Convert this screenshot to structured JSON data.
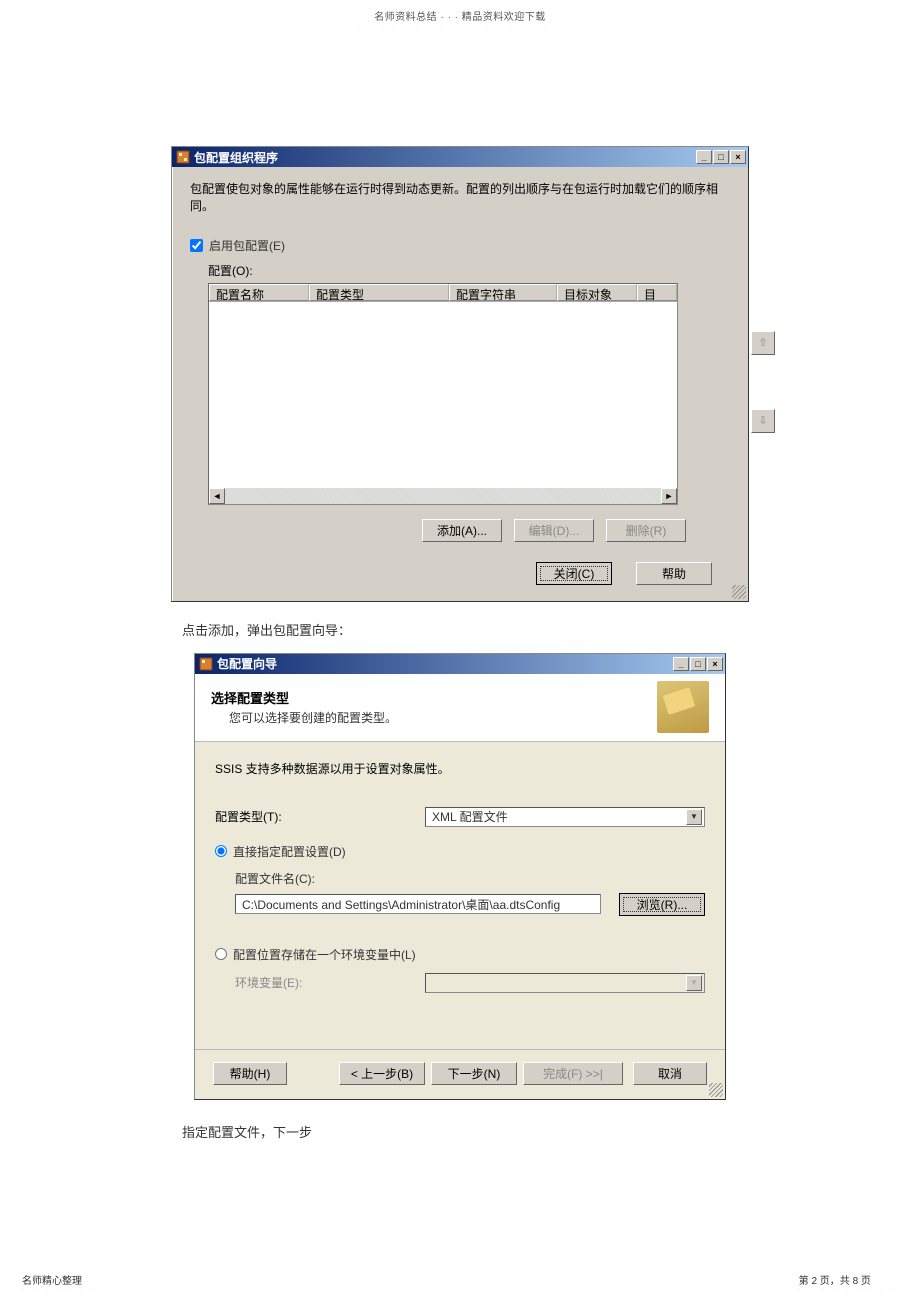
{
  "page_header": {
    "text": "名师资料总结 · · · 精品资料欢迎下载"
  },
  "dialog1": {
    "title": "包配置组织程序",
    "description": "包配置使包对象的属性能够在运行时得到动态更新。配置的列出顺序与在包运行时加载它们的顺序相同。",
    "enable_checkbox": "启用包配置(E)",
    "config_label": "配置(O):",
    "columns": [
      "配置名称",
      "配置类型",
      "配置字符串",
      "目标对象",
      "目"
    ],
    "buttons": {
      "add": "添加(A)...",
      "edit": "编辑(D)...",
      "delete": "删除(R)",
      "close": "关闭(C)",
      "help": "帮助"
    }
  },
  "note1": "点击添加，弹出包配置向导：",
  "dialog2": {
    "title": "包配置向导",
    "header_title": "选择配置类型",
    "header_sub": "您可以选择要创建的配置类型。",
    "desc": "SSIS 支持多种数据源以用于设置对象属性。",
    "config_type_label": "配置类型(T):",
    "config_type_value": "XML 配置文件",
    "radio1": "直接指定配置设置(D)",
    "file_label": "配置文件名(C):",
    "file_value": "C:\\Documents and Settings\\Administrator\\桌面\\aa.dtsConfig",
    "browse": "浏览(R)...",
    "radio2": "配置位置存储在一个环境变量中(L)",
    "env_label": "环境变量(E):",
    "buttons": {
      "help": "帮助(H)",
      "back": "< 上一步(B)",
      "next": "下一步(N)",
      "finish": "完成(F) >>|",
      "cancel": "取消"
    }
  },
  "note2": "指定配置文件，下一步",
  "footer": {
    "left": "名师精心整理",
    "right": "第 2 页，共 8 页"
  }
}
